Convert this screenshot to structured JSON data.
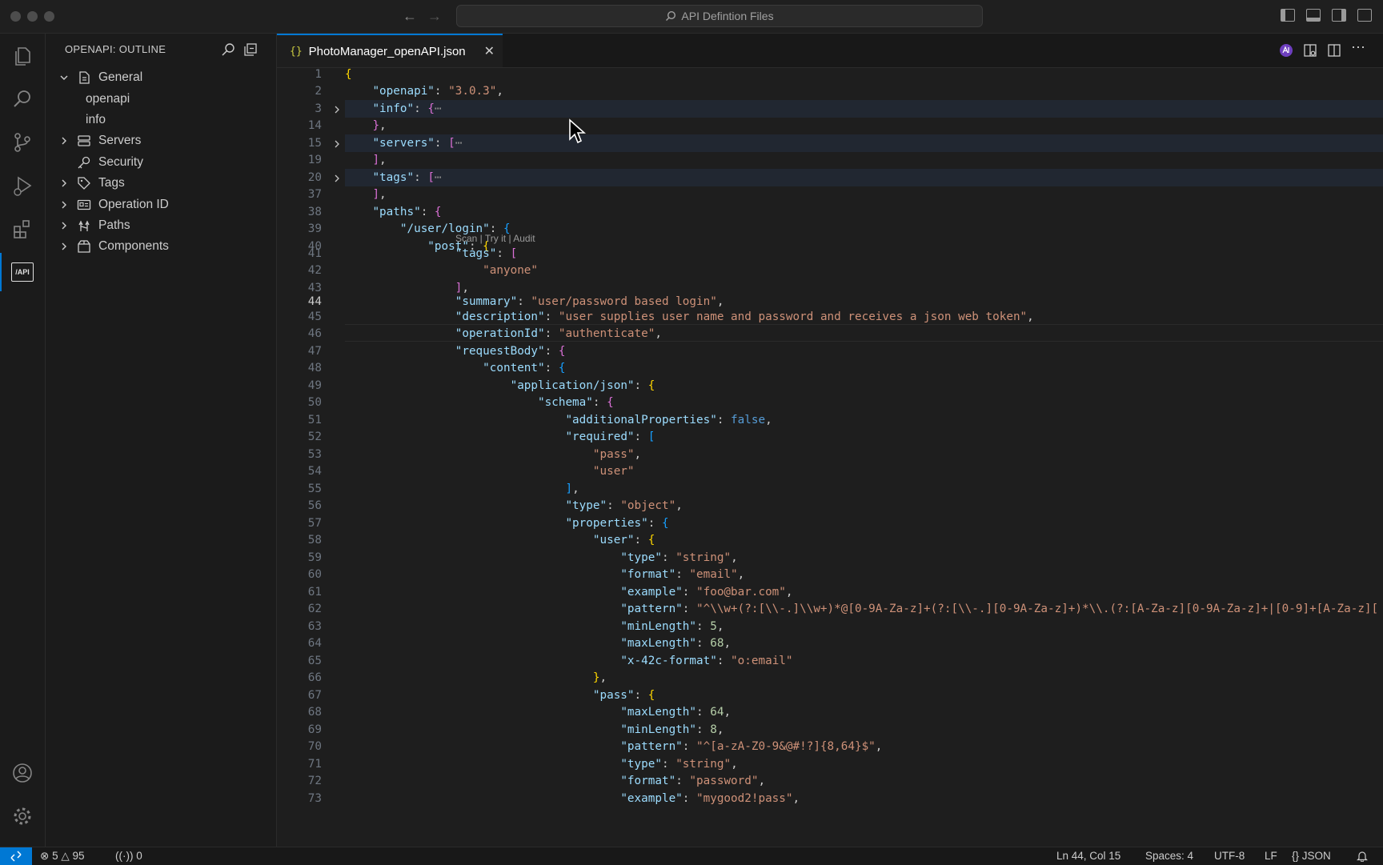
{
  "window": {
    "command_center": "API Defintion Files"
  },
  "activity_bar": {
    "items": [
      "explorer-icon",
      "search-icon",
      "source-control-icon",
      "run-debug-icon",
      "extensions-icon",
      "api-icon"
    ],
    "api_label": "/API",
    "bottom": [
      "account-icon",
      "settings-gear-icon"
    ]
  },
  "sidebar": {
    "title": "OPENAPI: OUTLINE",
    "items": [
      {
        "label": "General",
        "expanded": true,
        "icon": "document-icon"
      },
      {
        "label": "openapi",
        "leaf": true
      },
      {
        "label": "info",
        "leaf": true
      },
      {
        "label": "Servers",
        "icon": "server-icon"
      },
      {
        "label": "Security",
        "icon": "key-icon"
      },
      {
        "label": "Tags",
        "icon": "tag-icon"
      },
      {
        "label": "Operation ID",
        "icon": "id-card-icon"
      },
      {
        "label": "Paths",
        "icon": "paths-icon"
      },
      {
        "label": "Components",
        "icon": "box-icon"
      }
    ]
  },
  "editor": {
    "tab_icon": "{}",
    "tab_title": "PhotoManager_openAPI.json",
    "codelens": "Scan | Try it | Audit",
    "line_numbers": [
      "1",
      "2",
      "3",
      "14",
      "15",
      "19",
      "20",
      "37",
      "38",
      "39",
      "40",
      "41",
      "42",
      "43",
      "44",
      "45",
      "46",
      "47",
      "48",
      "49",
      "50",
      "51",
      "52",
      "53",
      "54",
      "55",
      "56",
      "57",
      "58",
      "59",
      "60",
      "61",
      "62",
      "63",
      "64",
      "65",
      "66",
      "67",
      "68",
      "69",
      "70",
      "71",
      "72",
      "73"
    ],
    "current_line": "44"
  },
  "status": {
    "errors": "5",
    "warnings": "95",
    "ports": "0",
    "position": "Ln 44, Col 15",
    "spaces": "Spaces: 4",
    "encoding": "UTF-8",
    "eol": "LF",
    "language": "JSON"
  },
  "colors": {
    "accent": "#0078d4",
    "key": "#9cdcfe",
    "string": "#ce9178",
    "number": "#b5cea8",
    "boolean": "#569cd6"
  }
}
